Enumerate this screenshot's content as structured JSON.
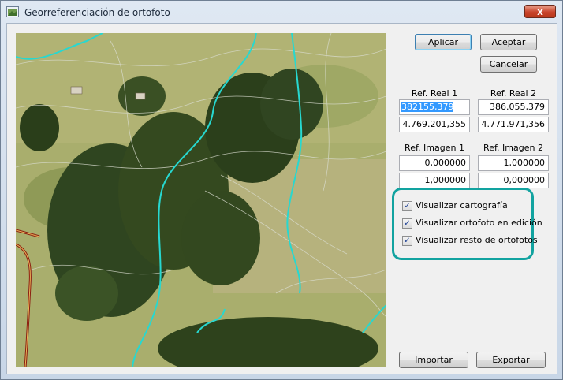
{
  "window": {
    "title": "Georreferenciación de ortofoto",
    "close_label": "x"
  },
  "buttons": {
    "apply": "Aplicar",
    "accept": "Aceptar",
    "cancel": "Cancelar",
    "import": "Importar",
    "export": "Exportar"
  },
  "ref_real": {
    "header_1": "Ref. Real 1",
    "header_2": "Ref. Real 2",
    "x1": "382155,379",
    "x2": "386.055,379",
    "y1": "4.769.201,355",
    "y2": "4.771.971,356"
  },
  "ref_image": {
    "header_1": "Ref. Imagen 1",
    "header_2": "Ref. Imagen 2",
    "x1": "0,000000",
    "x2": "1,000000",
    "y1": "1,000000",
    "y2": "0,000000"
  },
  "options": [
    {
      "label": "Visualizar cartografía",
      "checked": true
    },
    {
      "label": "Visualizar ortofoto en edición",
      "checked": true
    },
    {
      "label": "Visualizar resto de ortofotos",
      "checked": true
    }
  ],
  "colors": {
    "highlight": "#12a3a0",
    "river": "#27d8d0",
    "road": "#8b1e10",
    "selection": "#3399ff"
  }
}
